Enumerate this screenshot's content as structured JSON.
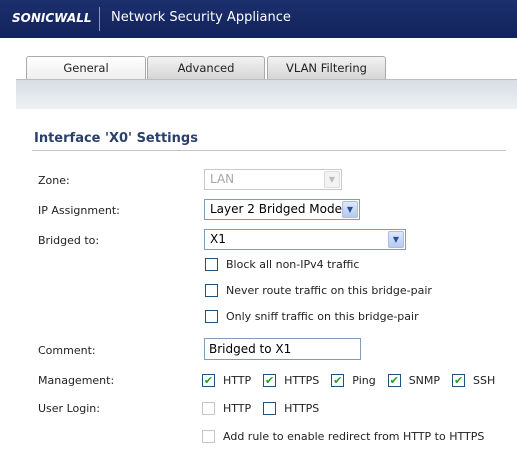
{
  "header": {
    "logo": "SONICWALL",
    "title": "Network Security Appliance"
  },
  "tabs": [
    {
      "label": "General",
      "active": true
    },
    {
      "label": "Advanced",
      "active": false
    },
    {
      "label": "VLAN Filtering",
      "active": false
    }
  ],
  "section": {
    "title": "Interface 'X0' Settings"
  },
  "fields": {
    "zone": {
      "label": "Zone:",
      "value": "LAN",
      "disabled": true
    },
    "ip_assignment": {
      "label": "IP Assignment:",
      "value": "Layer 2 Bridged Mode"
    },
    "bridged_to": {
      "label": "Bridged to:",
      "value": "X1"
    },
    "comment": {
      "label": "Comment:",
      "value": "Bridged to X1"
    },
    "management": {
      "label": "Management:"
    },
    "user_login": {
      "label": "User Login:"
    }
  },
  "bridge_options": [
    {
      "label": "Block all non-IPv4 traffic",
      "checked": false
    },
    {
      "label": "Never route traffic on this bridge-pair",
      "checked": false
    },
    {
      "label": "Only sniff traffic on this bridge-pair",
      "checked": false
    }
  ],
  "management_options": [
    {
      "label": "HTTP",
      "checked": true
    },
    {
      "label": "HTTPS",
      "checked": true
    },
    {
      "label": "Ping",
      "checked": true
    },
    {
      "label": "SNMP",
      "checked": true
    },
    {
      "label": "SSH",
      "checked": true
    }
  ],
  "user_login_options": [
    {
      "label": "HTTP",
      "checked": false,
      "disabled": true
    },
    {
      "label": "HTTPS",
      "checked": false
    }
  ],
  "redirect_option": {
    "label": "Add rule to enable redirect from HTTP to HTTPS",
    "checked": false,
    "disabled": true
  },
  "icons": {
    "checkmark": "check-icon",
    "dropdown": "chevron-down-icon"
  },
  "colors": {
    "header_bg": "#1c2f6e",
    "section_title": "#2b3f6c",
    "check": "#21a121"
  }
}
